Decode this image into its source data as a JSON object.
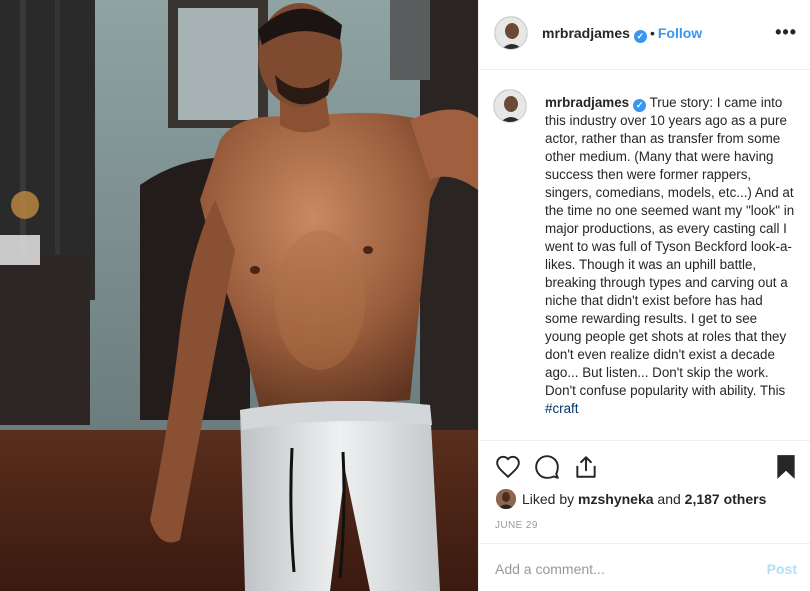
{
  "post": {
    "photo_alt": "",
    "author": {
      "username": "mrbradjames",
      "verified": true,
      "verified_icon": "verified-badge-icon"
    },
    "follow_label": "Follow",
    "separator": "•",
    "more_label": "•••",
    "caption": {
      "username": "mrbradjames",
      "text": "True story: I came into this industry over 10 years ago as a pure actor, rather than as transfer from some other medium. (Many that were having success then were former rappers, singers, comedians, models, etc...) And at the time no one seemed want my \"look\" in major productions, as every casting call I went to was full of Tyson Beckford look-a-likes. Though it was an uphill battle, breaking through types and carving out a niche that didn't exist before has had some rewarding results. I get to see young people get shots at roles that they don't even realize didn't exist a decade ago... But listen... Don't skip the work. Don't confuse popularity with ability. This",
      "hashtag": "#craft"
    },
    "actions": {
      "like_icon": "heart-icon",
      "comment_icon": "comment-bubble-icon",
      "share_icon": "share-icon",
      "save_icon": "bookmark-icon"
    },
    "likes": {
      "prefix": "Liked by",
      "user": "mzshyneka",
      "conjunction": "and",
      "count_text": "2,187 others"
    },
    "date": "JUNE 29",
    "comment": {
      "placeholder": "Add a comment...",
      "post_label": "Post"
    }
  },
  "colors": {
    "accent": "#3897f0",
    "text": "#262626",
    "muted": "#999999",
    "hashtag": "#003569",
    "post_disabled": "#b2dffc",
    "divider": "#efefef"
  }
}
